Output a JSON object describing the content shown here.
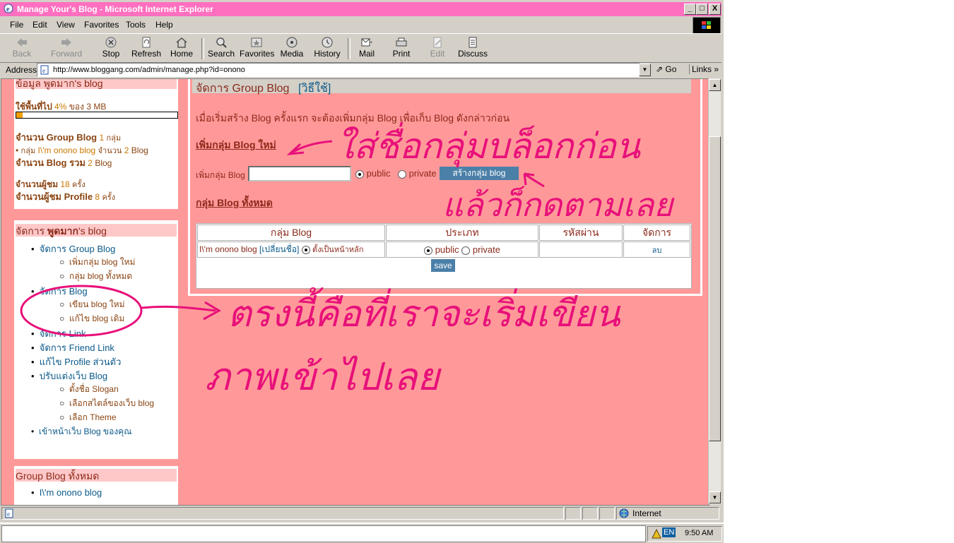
{
  "window": {
    "title": "Manage Your's Blog - Microsoft Internet Explorer",
    "minimize": "_",
    "maximize": "□",
    "close": "X"
  },
  "menu": [
    "File",
    "Edit",
    "View",
    "Favorites",
    "Tools",
    "Help"
  ],
  "toolbar": {
    "back": "Back",
    "forward": "Forward",
    "stop": "Stop",
    "refresh": "Refresh",
    "home": "Home",
    "search": "Search",
    "favorites": "Favorites",
    "media": "Media",
    "history": "History",
    "mail": "Mail",
    "print": "Print",
    "edit": "Edit",
    "discuss": "Discuss"
  },
  "address": {
    "label": "Address",
    "url": "http://www.bloggang.com/admin/manage.php?id=onono",
    "go": "Go",
    "links": "Links"
  },
  "sidebar": {
    "stats_header": "ข้อมูล พูดมาก's blog",
    "usage_label": "ใช้พื้นที่ไป",
    "usage_percent": "4%",
    "usage_of": "ของ 3 MB",
    "usage_fraction": 0.04,
    "group_count_label": "จำนวน Group Blog",
    "group_count": "1",
    "group_count_unit": "กลุ่ม",
    "group_line_prefix": "กลุ่ม",
    "group_line_name": "I\\'m onono blog",
    "group_line_count_label": "จำนวน",
    "group_line_count": "2",
    "group_line_unit": "Blog",
    "blog_total_label": "จำนวน Blog รวม",
    "blog_total": "2",
    "blog_total_unit": "Blog",
    "visitors_label": "จำนวนผู้ชม",
    "visitors": "18",
    "visitors_unit": "ครั้ง",
    "profile_visitors_label": "จำนวนผู้ชม Profile",
    "profile_visitors": "8",
    "profile_visitors_unit": "ครั้ง",
    "manage_header_prefix": "จัดการ",
    "manage_header_name": "พูดมาก",
    "manage_header_suffix": "'s blog",
    "nav": {
      "group_blog": "จัดการ Group Blog",
      "add_group": "เพิ่มกลุ่ม blog ใหม่",
      "all_groups": "กลุ่ม blog ทั้งหมด",
      "blog": "จัดการ Blog",
      "write_blog": "เขียน blog ใหม่",
      "edit_blog": "แก้ไข blog เดิม",
      "link": "จัดการ Link",
      "friend_link": "จัดการ Friend Link",
      "edit_profile": "แก้ไข Profile ส่วนตัว",
      "customize": "ปรับแต่งเว็บ Blog",
      "slogan": "ตั้งชื่อ Slogan",
      "style": "เลือกสไตล์ของเว็บ blog",
      "theme": "เลือก Theme",
      "go_blog": "เข้าหน้าเว็บ Blog ของคุณ"
    },
    "all_groups_header": "Group Blog ทั้งหมด",
    "all_groups_item": "I\\'m onono blog"
  },
  "main": {
    "header": "จัดการ Group Blog",
    "header_link": "[วิธีใช้]",
    "intro": "เมื่อเริ่มสร้าง Blog ครั้งแรก จะต้องเพิ่มกลุ่ม Blog เพื่อเก็บ Blog ดังกล่าวก่อน",
    "add_section": "เพิ่มกลุ่ม Blog ใหม่",
    "add_label": "เพิ่มกลุ่ม Blog",
    "add_input_value": "",
    "public": "public",
    "private": "private",
    "create_button": "สร้างกลุ่ม blog",
    "all_section": "กลุ่ม Blog ทั้งหมด",
    "table_headers": [
      "กลุ่ม Blog",
      "ประเภท",
      "รหัสผ่าน",
      "จัดการ"
    ],
    "row_name": "I\\'m onono blog",
    "row_rename": "[เปลี่ยนชื่อ]",
    "row_home": "ตั้งเป็นหน้าหลัก",
    "row_public": "public",
    "row_private": "private",
    "row_delete": "ลบ",
    "save": "save"
  },
  "annotations": {
    "note1": "ใส่ชื่อกลุ่มบล็อกก่อน",
    "note2": "แล้วก็กดตามเลย",
    "note3": "ตรงนี้คือที่เราจะเริ่มเขียน",
    "note4": "ภาพเข้าไปเลย",
    "color": "#e8107a"
  },
  "status": {
    "zone": "Internet"
  },
  "taskbar": {
    "lang": "EN",
    "time": "9:50 AM"
  }
}
